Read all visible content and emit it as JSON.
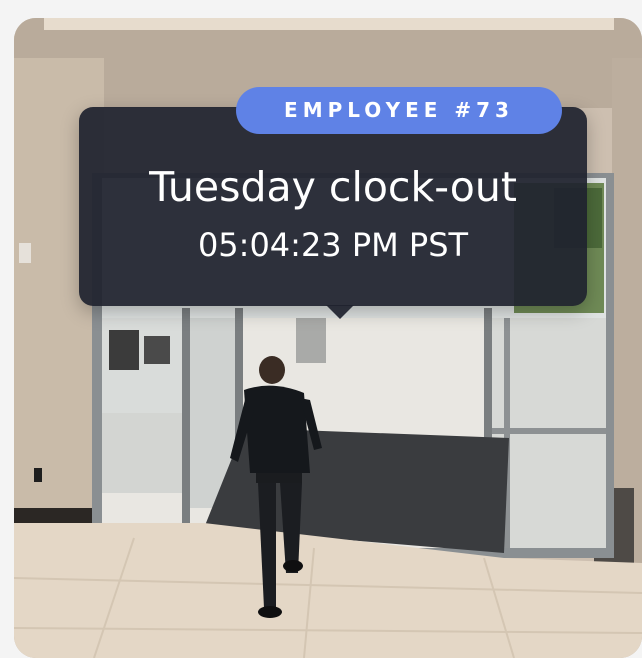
{
  "badge": {
    "label": "EMPLOYEE #73"
  },
  "event": {
    "title": "Tuesday clock-out",
    "time": "05:04:23 PM PST"
  },
  "colors": {
    "badge_bg": "#5f82e6",
    "overlay_bg": "#1f222e",
    "text": "#ffffff"
  }
}
